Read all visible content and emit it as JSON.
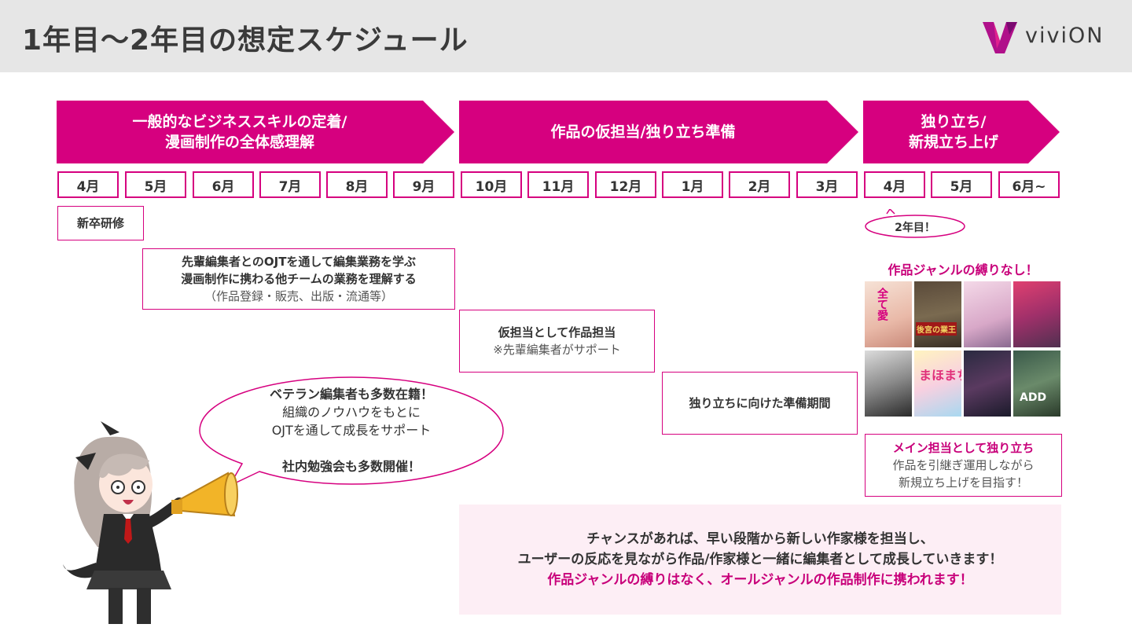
{
  "header": {
    "title": "1年目〜2年目の想定スケジュール",
    "logo_text": "viviON"
  },
  "phases": [
    {
      "line1": "一般的なビジネススキルの定着/",
      "line2": "漫画制作の全体感理解"
    },
    {
      "line1": "作品の仮担当/独り立ち準備",
      "line2": ""
    },
    {
      "line1": "独り立ち/",
      "line2": "新規立ち上げ"
    }
  ],
  "months": [
    "4月",
    "5月",
    "6月",
    "7月",
    "8月",
    "9月",
    "10月",
    "11月",
    "12月",
    "1月",
    "2月",
    "3月",
    "4月",
    "5月",
    "6月~"
  ],
  "boxes": {
    "training": "新卒研修",
    "ojt": {
      "line1": "先輩編集者とのOJTを通して編集業務を学ぶ",
      "line2": "漫画制作に携わる他チームの業務を理解する",
      "line3": "（作品登録・販売、出版・流通等）"
    },
    "provisional": {
      "line1": "仮担当として作品担当",
      "line2": "※先輩編集者がサポート"
    },
    "prep": "独り立ちに向けた準備期間",
    "main": {
      "line1": "メイン担当として独り立ち",
      "line2": "作品を引継ぎ運用しながら",
      "line3": "新規立ち上げを目指す！"
    }
  },
  "badge": "2年目！",
  "genre_title": "作品ジャンルの縛りなし！",
  "covers": [
    "全て愛",
    "後宮の業王",
    "",
    "",
    "",
    "まほまち",
    "",
    "ADD"
  ],
  "bubble": {
    "line1": "ベテラン編集者も多数在籍！",
    "line2": "組織のノウハウをもとに",
    "line3": "OJTを通して成長をサポート",
    "line4": "社内勉強会も多数開催！"
  },
  "bottom": {
    "line1": "チャンスがあれば、早い段階から新しい作家様を担当し、",
    "line2": "ユーザーの反応を見ながら作品/作家様と一緒に編集者として成長していきます！",
    "line3": "作品ジャンルの縛りはなく、オールジャンルの作品制作に携われます！"
  },
  "colors": {
    "accent": "#d6007f",
    "header_bg": "#e6e6e6",
    "bottom_bg": "#fdeef5"
  }
}
